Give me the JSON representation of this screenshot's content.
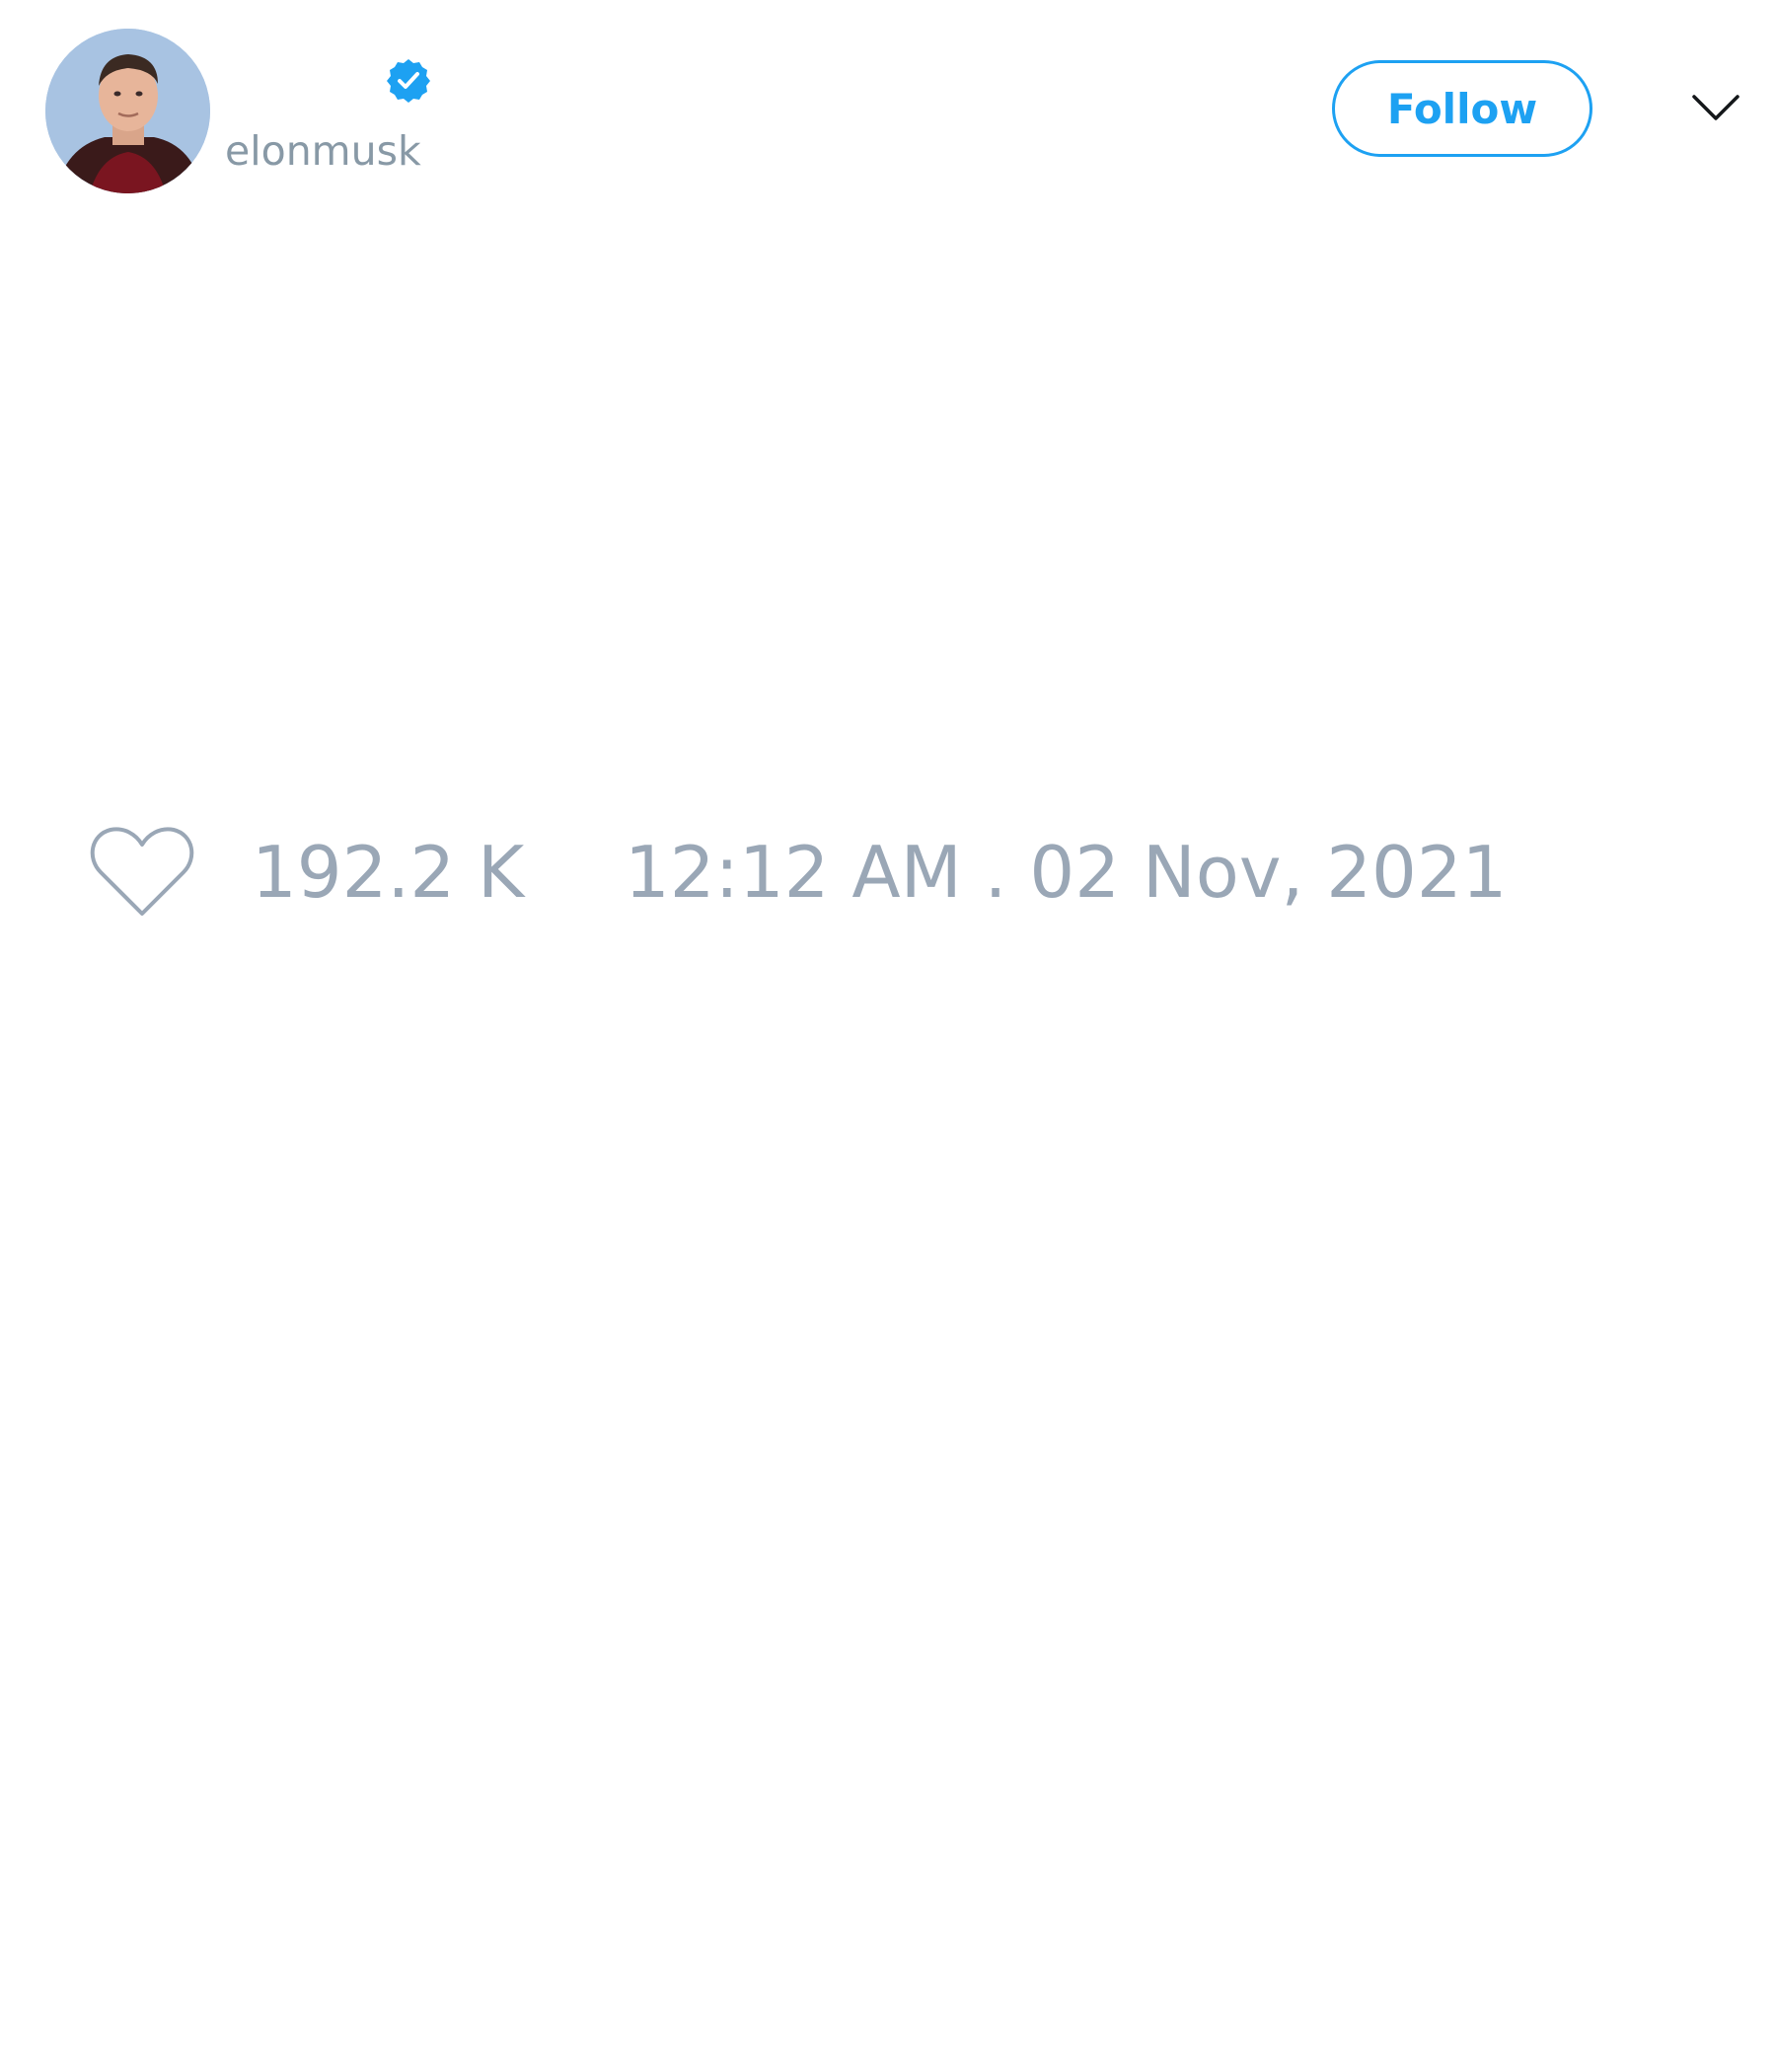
{
  "user": {
    "display_name": "",
    "handle": "elonmusk",
    "verified": true,
    "avatar_icon": "profile-photo"
  },
  "header": {
    "follow_label": "Follow",
    "menu_icon": "chevron-down-icon"
  },
  "tweet": {
    "text": ""
  },
  "actions": {
    "like_icon": "heart-icon",
    "like_count": "192.2 K",
    "timestamp": "12:12 AM . 02 Nov, 2021"
  },
  "colors": {
    "accent": "#1da1f2",
    "muted_text": "#9aa7b6",
    "handle_text": "#8899a6",
    "background": "#ffffff"
  }
}
